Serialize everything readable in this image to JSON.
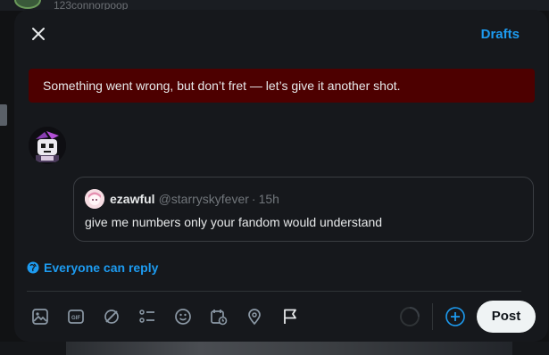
{
  "background": {
    "handle": "123connorpoop"
  },
  "modal": {
    "drafts_label": "Drafts",
    "error_message": "Something went wrong, but don’t fret — let’s give it another shot."
  },
  "quote": {
    "name": "ezawful",
    "handle": "@starryskyfever",
    "separator": "·",
    "time": "15h",
    "text": "give me numbers only your fandom would understand"
  },
  "reply_setting": {
    "label": "Everyone can reply"
  },
  "toolbar": {
    "icons": [
      "media-icon",
      "gif-icon",
      "grok-icon",
      "poll-icon",
      "emoji-icon",
      "schedule-icon",
      "location-icon",
      "flag-icon"
    ]
  },
  "actions": {
    "post_label": "Post"
  },
  "colors": {
    "accent": "#1d9bf0",
    "error_bg": "#4d0000",
    "modal_bg": "#16181c",
    "post_bg": "#eff3f4"
  }
}
